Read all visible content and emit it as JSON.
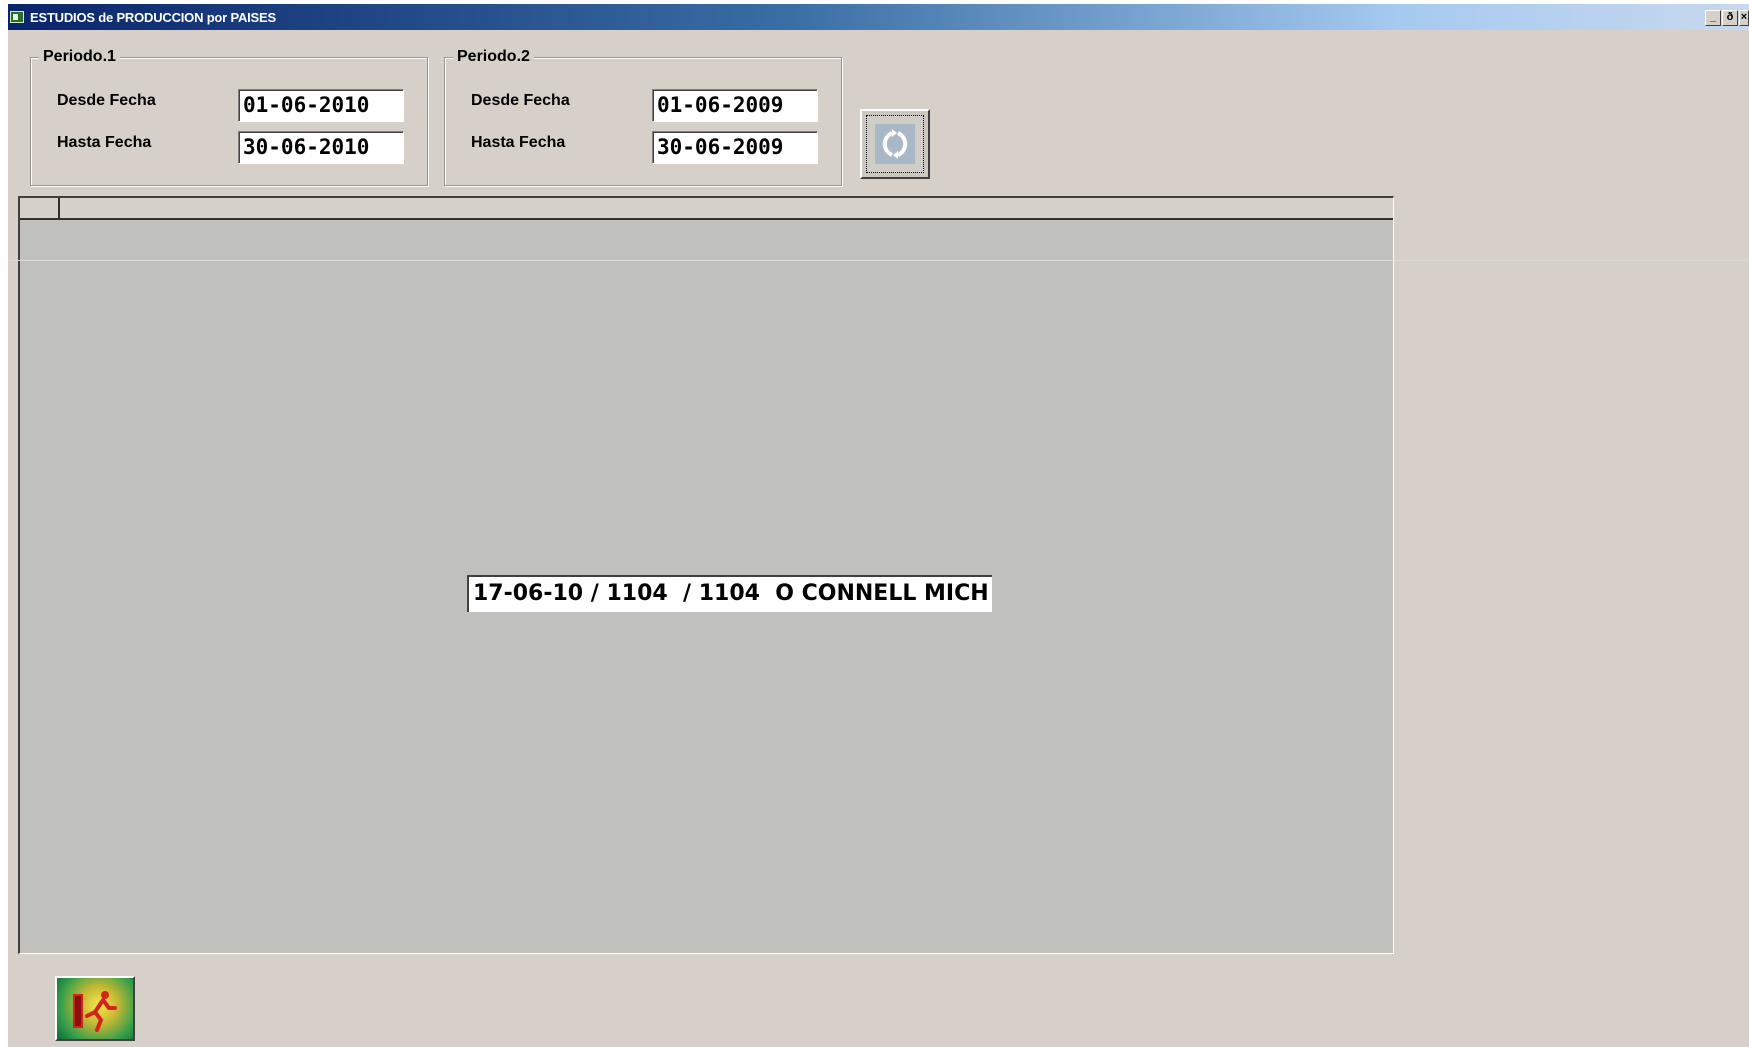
{
  "window": {
    "title": "ESTUDIOS de PRODUCCION por PAISES",
    "controls": {
      "minimize": "_",
      "restore": "ð",
      "close": "×"
    }
  },
  "periodo1": {
    "legend": "Periodo.1",
    "desde_label": "Desde Fecha",
    "desde_value": "01-06-2010",
    "hasta_label": "Hasta Fecha",
    "hasta_value": "30-06-2010"
  },
  "periodo2": {
    "legend": "Periodo.2",
    "desde_label": "Desde Fecha",
    "desde_value": "01-06-2009",
    "hasta_label": "Hasta Fecha",
    "hasta_value": "30-06-2009"
  },
  "refresh_button": {
    "icon": "refresh-icon"
  },
  "grid": {
    "current_record": "17-06-10 / 1104  / 1104  O CONNELL MICH"
  },
  "exit_button": {
    "icon": "exit-running-man-icon"
  },
  "colors": {
    "titlebar_start": "#0a246a",
    "titlebar_end": "#a6caf0",
    "window_bg": "#d6d0c8",
    "grid_bg": "#c0c0bc"
  }
}
